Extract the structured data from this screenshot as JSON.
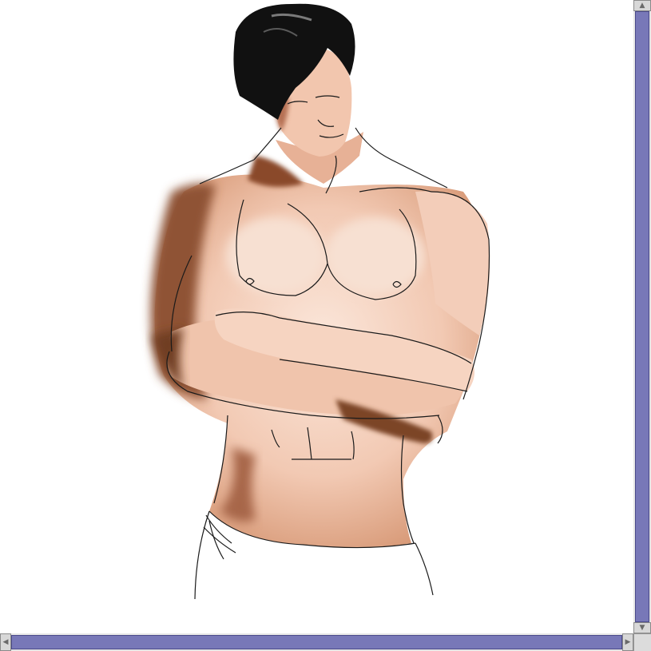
{
  "canvas": {
    "background": "#ffffff",
    "artwork": "digital-painting"
  },
  "scrollbars": {
    "thumb_color": "#7878b8",
    "track_color": "#e6e6e6",
    "vertical": {
      "up_glyph": "▲",
      "down_glyph": "▼"
    },
    "horizontal": {
      "left_glyph": "◀",
      "right_glyph": "▶"
    }
  },
  "colors": {
    "skin_light": "#f6d9c8",
    "skin_mid": "#e9b59a",
    "skin_shadow": "#9a5a3a",
    "hair": "#121212",
    "line": "#1a1a1a"
  }
}
